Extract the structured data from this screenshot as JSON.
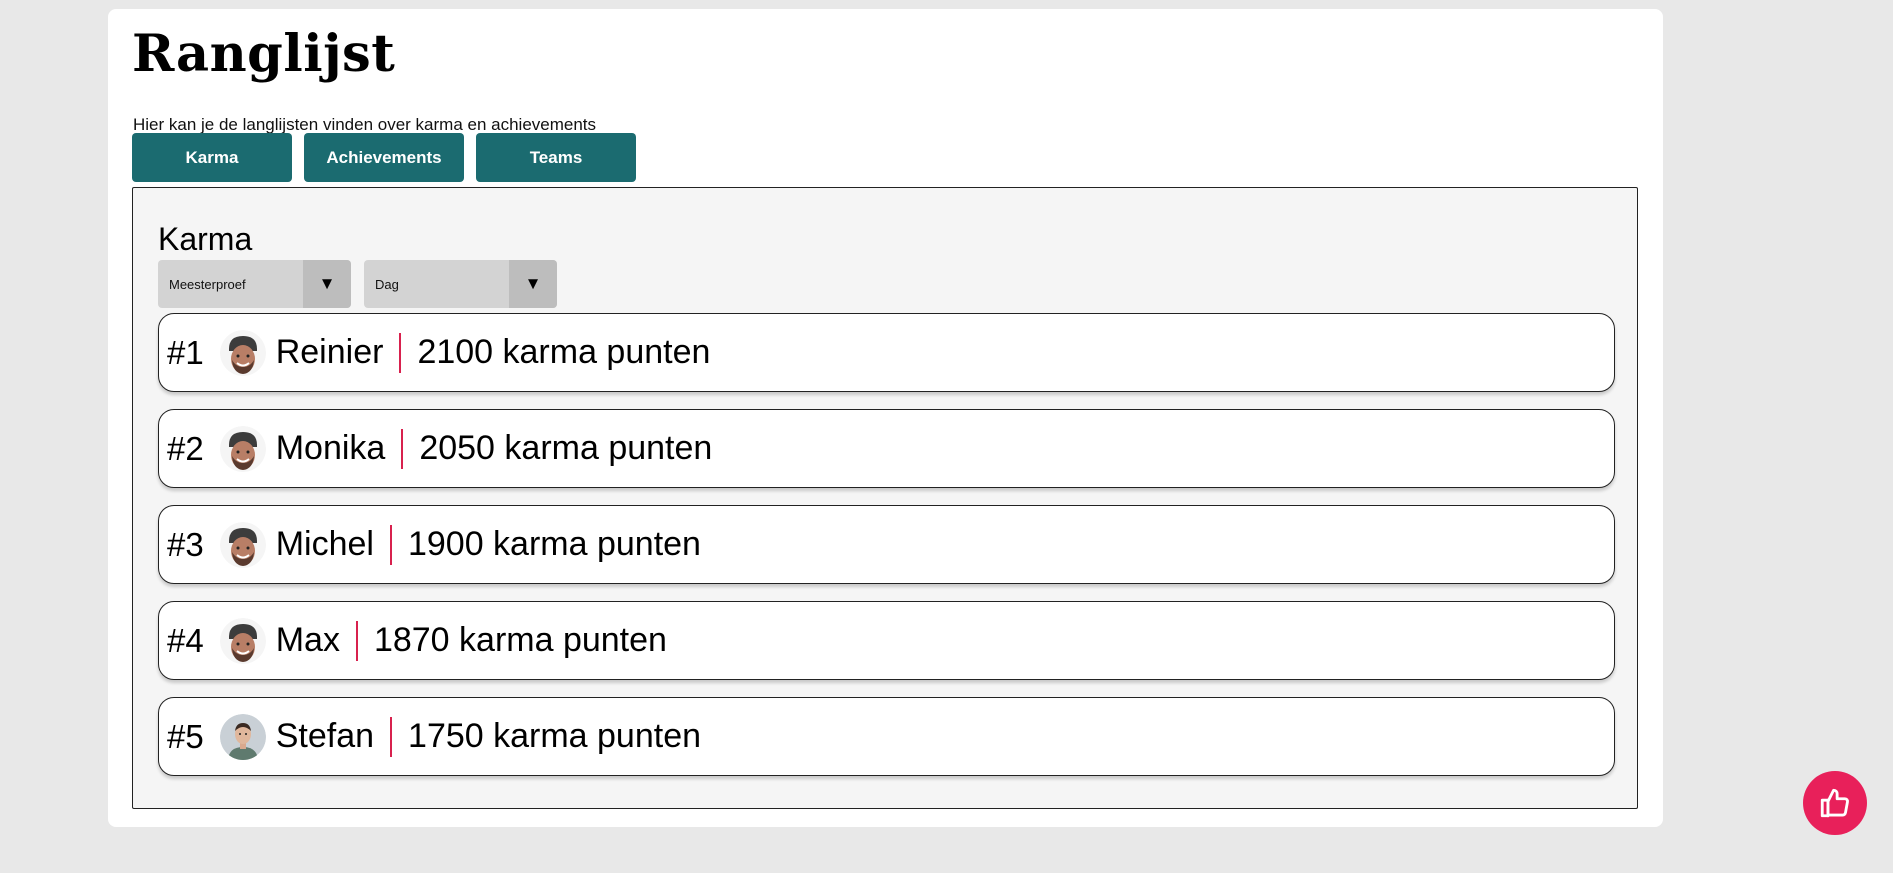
{
  "page": {
    "title": "Ranglijst",
    "subtitle": "Hier kan je de langlijsten vinden over karma en achievements"
  },
  "tabs": [
    {
      "label": "Karma"
    },
    {
      "label": "Achievements"
    },
    {
      "label": "Teams"
    }
  ],
  "panel": {
    "title": "Karma",
    "filters": {
      "project": {
        "value": "Meesterproef"
      },
      "period": {
        "value": "Dag"
      }
    }
  },
  "leaderboard": [
    {
      "rank": "#1",
      "name": "Reinier",
      "points": "2100 karma punten",
      "avatar": "avatar-beanie"
    },
    {
      "rank": "#2",
      "name": "Monika",
      "points": "2050 karma punten",
      "avatar": "avatar-beanie"
    },
    {
      "rank": "#3",
      "name": "Michel",
      "points": "1900 karma punten",
      "avatar": "avatar-beanie"
    },
    {
      "rank": "#4",
      "name": "Max",
      "points": "1870 karma punten",
      "avatar": "avatar-beanie"
    },
    {
      "rank": "#5",
      "name": "Stefan",
      "points": "1750 karma punten",
      "avatar": "avatar-portrait"
    }
  ],
  "icons": {
    "dropdown": "triangle-down-icon",
    "like": "thumbs-up-icon"
  },
  "colors": {
    "tab_button": "#1b6b70",
    "separator": "#d8214e",
    "like_button": "#e8205a"
  }
}
